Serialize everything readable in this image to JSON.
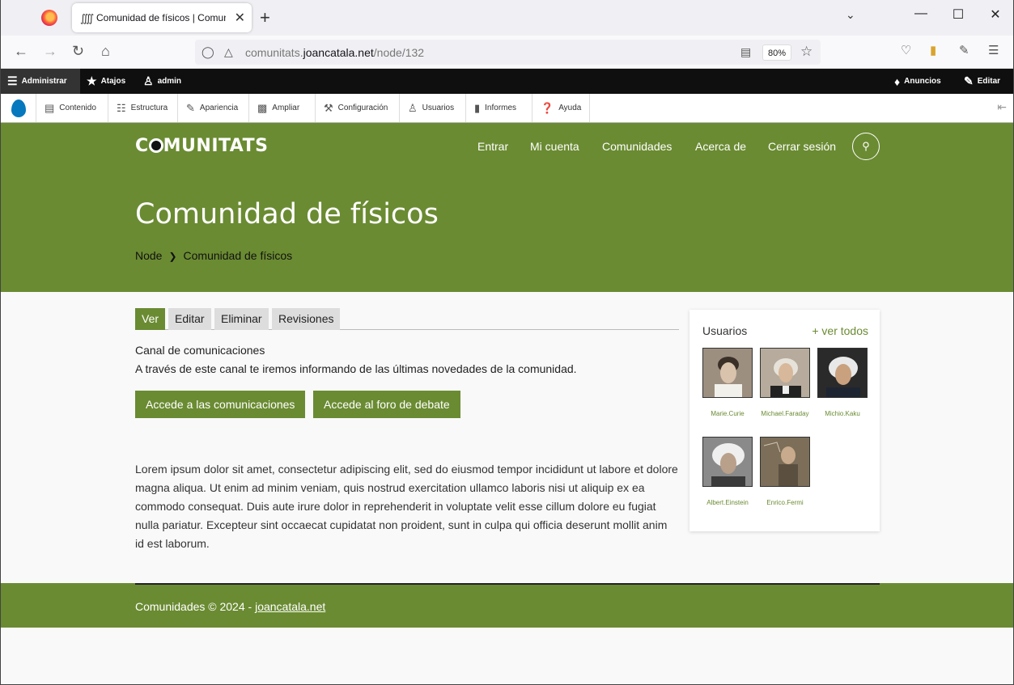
{
  "browser": {
    "tab_title": "Comunidad de físicos | Comuni",
    "url_prefix": "comunitats.",
    "url_domain": "joancatala.net",
    "url_path": "/node/132",
    "zoom": "80%"
  },
  "admin_bar": {
    "administrar": "Administrar",
    "atajos": "Atajos",
    "user": "admin",
    "anuncios": "Anuncios",
    "editar": "Editar"
  },
  "tray": {
    "items": [
      "Contenido",
      "Estructura",
      "Apariencia",
      "Ampliar",
      "Configuración",
      "Usuarios",
      "Informes",
      "Ayuda"
    ]
  },
  "site": {
    "logo_pre": "C",
    "logo_post": "MUNITATS",
    "menu": [
      "Entrar",
      "Mi cuenta",
      "Comunidades",
      "Acerca de",
      "Cerrar sesión"
    ]
  },
  "page": {
    "title": "Comunidad de físicos",
    "breadcrumb": [
      "Node",
      "Comunidad de físicos"
    ],
    "tabs": [
      "Ver",
      "Editar",
      "Eliminar",
      "Revisiones"
    ],
    "heading": "Canal de comunicaciones",
    "intro": "A través de este canal te iremos informando de las últimas novedades de la comunidad.",
    "button_comms": "Accede a las comunicaciones",
    "button_forum": "Accede al foro de debate",
    "lorem": "Lorem ipsum dolor sit amet, consectetur adipiscing elit, sed do eiusmod tempor incididunt ut labore et dolore magna aliqua. Ut enim ad minim veniam, quis nostrud exercitation ullamco laboris nisi ut aliquip ex ea commodo consequat. Duis aute irure dolor in reprehenderit in voluptate velit esse cillum dolore eu fugiat nulla pariatur. Excepteur sint occaecat cupidatat non proident, sunt in culpa qui officia deserunt mollit anim id est laborum."
  },
  "sidebar": {
    "title": "Usuarios",
    "view_all": "+ ver todos",
    "users": [
      "Marie.Curie",
      "Michael.Faraday",
      "Michio.Kaku",
      "Albert.Einstein",
      "Enrico.Fermi"
    ]
  },
  "footer": {
    "text": "Comunidades © 2024 - ",
    "link": "joancatala.net"
  },
  "colors": {
    "brand_green": "#6a8b32",
    "admin_bar": "#0f0f0f"
  }
}
